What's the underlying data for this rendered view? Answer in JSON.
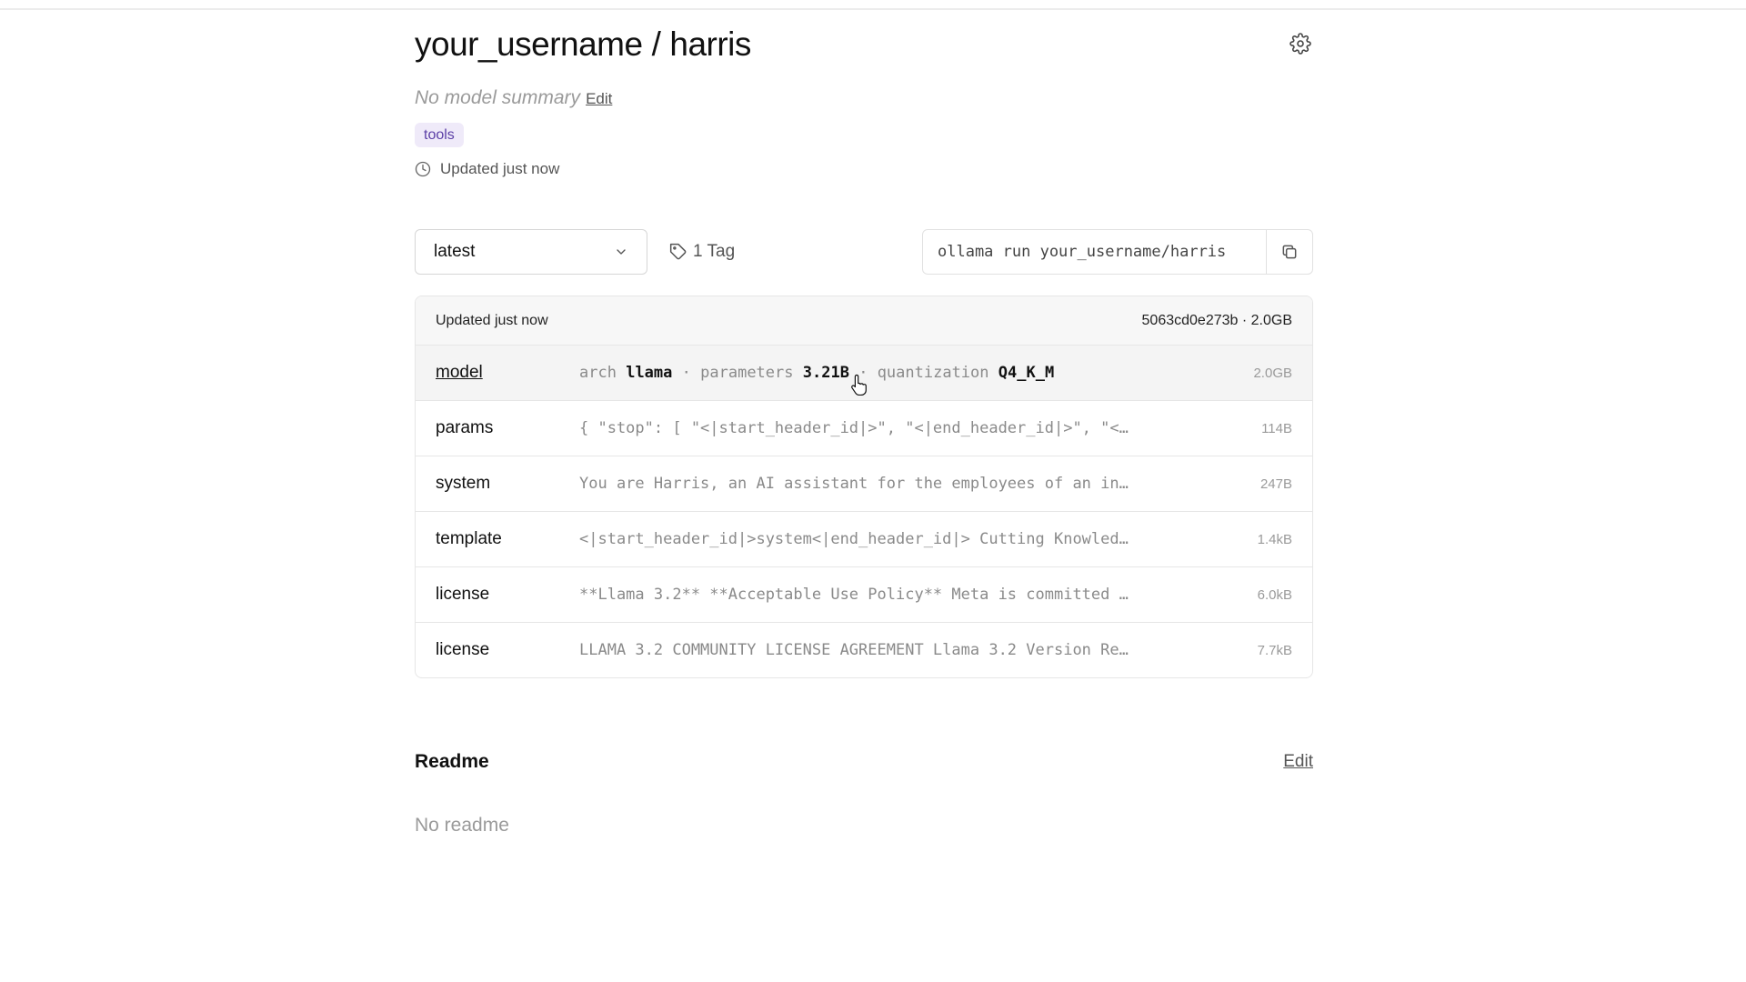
{
  "header": {
    "owner": "your_username",
    "separator": "/",
    "model": "harris"
  },
  "summary": {
    "text": "No model summary",
    "edit_label": "Edit"
  },
  "capability_tags": [
    "tools"
  ],
  "updated_text": "Updated just now",
  "controls": {
    "version_select": "latest",
    "tag_count": "1 Tag",
    "run_command": "ollama run your_username/harris"
  },
  "layers": {
    "header_left": "Updated just now",
    "header_right": "5063cd0e273b · 2.0GB",
    "rows": [
      {
        "name": "model",
        "arch_label": "arch",
        "arch": "llama",
        "dot": "·",
        "params_label": "parameters",
        "params": "3.21B",
        "quant_label": "quantization",
        "quant": "Q4_K_M",
        "size": "2.0GB"
      },
      {
        "name": "params",
        "desc": "{ \"stop\": [ \"<|start_header_id|>\", \"<|end_header_id|>\", \"<…",
        "size": "114B"
      },
      {
        "name": "system",
        "desc": "You are Harris, an AI assistant for the employees of an in…",
        "size": "247B"
      },
      {
        "name": "template",
        "desc": "<|start_header_id|>system<|end_header_id|> Cutting Knowled…",
        "size": "1.4kB"
      },
      {
        "name": "license",
        "desc": "**Llama 3.2** **Acceptable Use Policy** Meta is committed …",
        "size": "6.0kB"
      },
      {
        "name": "license",
        "desc": "LLAMA 3.2 COMMUNITY LICENSE AGREEMENT Llama 3.2 Version Re…",
        "size": "7.7kB"
      }
    ]
  },
  "readme": {
    "heading": "Readme",
    "edit_label": "Edit",
    "body": "No readme"
  },
  "colors": {
    "tag_bg": "#efeaf9",
    "tag_text": "#5b3fa6",
    "muted": "#9a9a9a"
  },
  "icons": {
    "settings": "gear-icon",
    "updated": "clock-icon",
    "select": "chevron-down-icon",
    "tag": "tag-icon",
    "copy": "copy-icon"
  }
}
